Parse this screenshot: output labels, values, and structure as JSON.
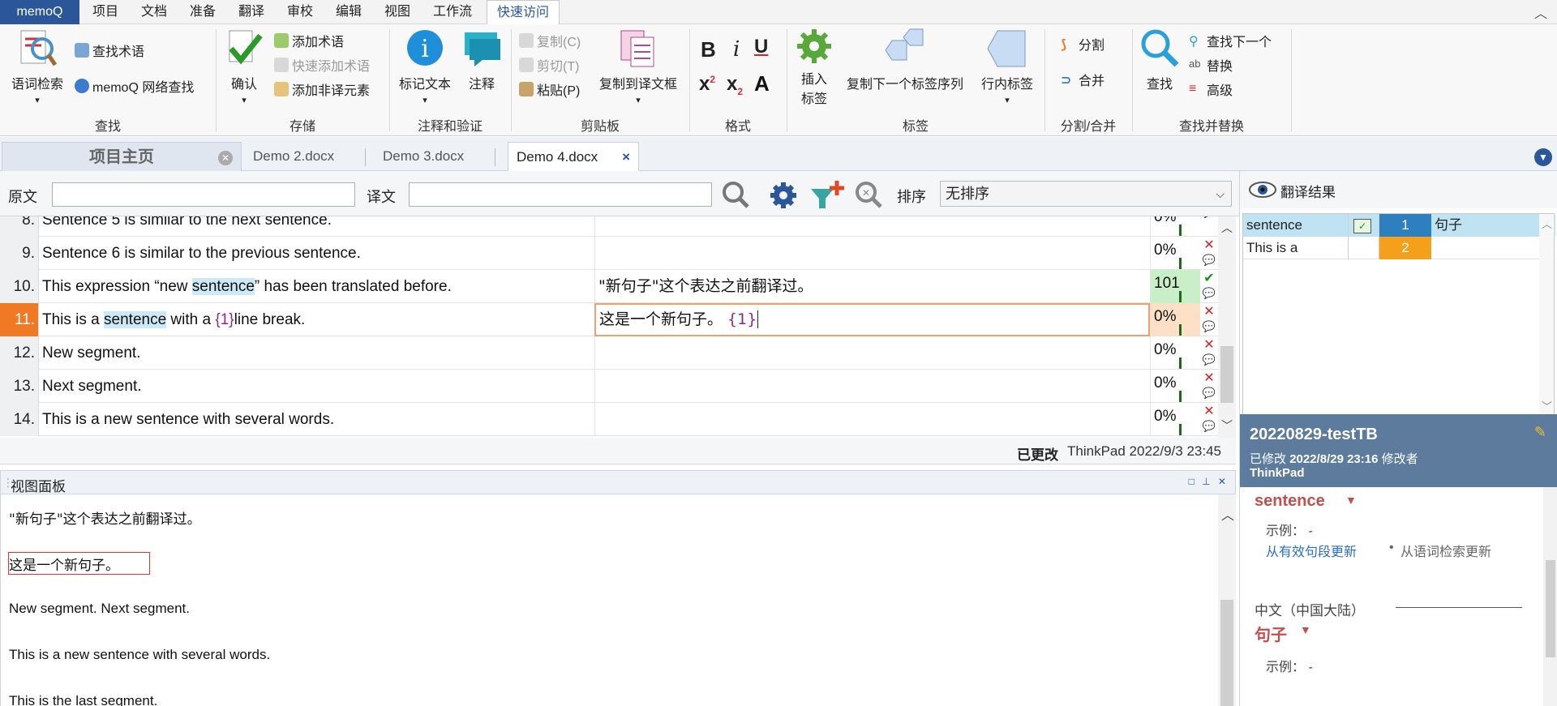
{
  "menubar": {
    "app": "memoQ",
    "items": [
      "项目",
      "文档",
      "准备",
      "翻译",
      "审校",
      "编辑",
      "视图",
      "工作流"
    ],
    "active": "快速访问"
  },
  "ribbon": {
    "groups": [
      {
        "title": "查找"
      },
      {
        "title": "存储"
      },
      {
        "title": "注释和验证"
      },
      {
        "title": "剪贴板"
      },
      {
        "title": "格式"
      },
      {
        "title": "标签"
      },
      {
        "title": "分割/合并"
      },
      {
        "title": "查找并替换"
      }
    ],
    "concordance": "语词检索",
    "find_term": "查找术语",
    "web_search": "memoQ 网络查找",
    "confirm": "确认",
    "add_term": "添加术语",
    "quick_add_term": "快速添加术语",
    "add_nontranslatable": "添加非译元素",
    "mark_text": "标记文本",
    "comment": "注释",
    "copy": "复制(C)",
    "cut": "剪切(T)",
    "paste": "粘贴(P)",
    "copy_to_target": "复制到译文框",
    "insert_tag": "插入\n标签",
    "insert_tag_l1": "插入",
    "insert_tag_l2": "标签",
    "copy_next_tag_seq": "复制下一个标签序列",
    "inline_tag": "行内标签",
    "split": "分割",
    "join": "合并",
    "find": "查找",
    "find_next": "查找下一个",
    "replace": "替换",
    "advanced": "高级"
  },
  "tabs": {
    "home": "项目主页",
    "docs": [
      "Demo 2.docx",
      "Demo 3.docx",
      "Demo 4.docx"
    ]
  },
  "filter": {
    "source_label": "原文",
    "target_label": "译文",
    "sort_label": "排序",
    "sort_value": "无排序",
    "source_value": "",
    "target_value": ""
  },
  "grid": {
    "rows": [
      {
        "num": "8.",
        "src": "Sentence 5 is similar to the next sentence.",
        "tgt": "",
        "pct": "0%",
        "status": "x"
      },
      {
        "num": "9.",
        "src": "Sentence 6 is similar to the previous sentence.",
        "tgt": "",
        "pct": "0%",
        "status": "x"
      },
      {
        "num": "10.",
        "src_pre": "This expression “new ",
        "src_hl": "sentence",
        "src_post": "” has been translated before.",
        "tgt": "\"新句子\"这个表达之前翻译过。",
        "pct": "101",
        "status": "ok"
      },
      {
        "num": "11.",
        "src_pre": "This is a ",
        "src_hl": "sentence",
        "src_mid": " with a ",
        "src_tag": "{1}",
        "src_post": "line break.",
        "tgt_pre": "这是一个新句子。 ",
        "tgt_tag": "{1}",
        "pct": "0%",
        "status": "x"
      },
      {
        "num": "12.",
        "src": "New segment.",
        "tgt": "",
        "pct": "0%",
        "status": "x"
      },
      {
        "num": "13.",
        "src": "Next segment.",
        "tgt": "",
        "pct": "0%",
        "status": "x"
      },
      {
        "num": "14.",
        "src": "This is a new sentence with several words.",
        "tgt": "",
        "pct": "0%",
        "status": "x"
      }
    ]
  },
  "infobar": {
    "changed": "已更改",
    "user_time": "ThinkPad 2022/9/3 23:45"
  },
  "viewpane": {
    "title": "视图面板",
    "lines": [
      "\"新句子\"这个表达之前翻译过。",
      "这是一个新句子。",
      "New segment. Next segment.",
      "This is a new sentence with several words.",
      "This is the last segment."
    ]
  },
  "results": {
    "title": "翻译结果",
    "rows": [
      {
        "src": "sentence",
        "num": "1",
        "tgt": "句子",
        "color": "#2e7fc0"
      },
      {
        "src": "This is a",
        "num": "2",
        "tgt": "",
        "color": "#f5a01a"
      }
    ]
  },
  "term": {
    "name": "20220829-testTB",
    "modified_label": "已修改",
    "modified_date": "2022/8/29 23:16",
    "modifier_label": "修改者",
    "modifier": "ThinkPad",
    "source_term": "sentence",
    "example_label": "示例：",
    "example_value": "-",
    "update_from_segment": "从有效句段更新",
    "update_from_concordance": "从语词检索更新",
    "lang": "中文（中国大陆）",
    "target_term": "句子",
    "example_label2": "示例：",
    "example_value2": "-"
  },
  "colors": {
    "accent": "#2b579a",
    "current_row": "#f07a23",
    "term_header": "#5d7b9c",
    "term_text": "#c0504d"
  }
}
